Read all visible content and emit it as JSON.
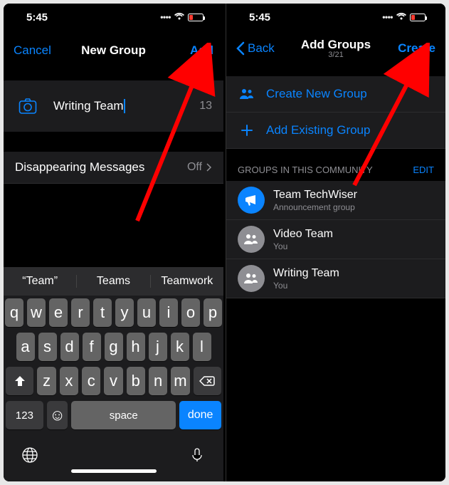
{
  "colors": {
    "accent": "#0a84ff",
    "danger": "#ff3b30"
  },
  "left": {
    "time": "5:45",
    "nav": {
      "cancel": "Cancel",
      "title": "New Group",
      "add": "Add"
    },
    "input": {
      "value": "Writing Team",
      "remaining": "13"
    },
    "disappearing": {
      "label": "Disappearing Messages",
      "value": "Off"
    },
    "suggestions": [
      "“Team”",
      "Teams",
      "Teamwork"
    ],
    "keys": {
      "row1": [
        "q",
        "w",
        "e",
        "r",
        "t",
        "y",
        "u",
        "i",
        "o",
        "p"
      ],
      "row2": [
        "a",
        "s",
        "d",
        "f",
        "g",
        "h",
        "j",
        "k",
        "l"
      ],
      "row3": [
        "z",
        "x",
        "c",
        "v",
        "b",
        "n",
        "m"
      ],
      "num": "123",
      "space": "space",
      "done": "done"
    }
  },
  "right": {
    "time": "5:45",
    "nav": {
      "back": "Back",
      "title": "Add Groups",
      "subtitle": "3/21",
      "create": "Create"
    },
    "options": {
      "createNew": "Create New Group",
      "addExisting": "Add Existing Group"
    },
    "sectionHeader": "GROUPS IN THIS COMMUNITY",
    "edit": "EDIT",
    "groups": [
      {
        "name": "Team TechWiser",
        "sub": "Announcement group",
        "announce": true
      },
      {
        "name": "Video Team",
        "sub": "You",
        "announce": false
      },
      {
        "name": "Writing Team",
        "sub": "You",
        "announce": false
      }
    ]
  }
}
